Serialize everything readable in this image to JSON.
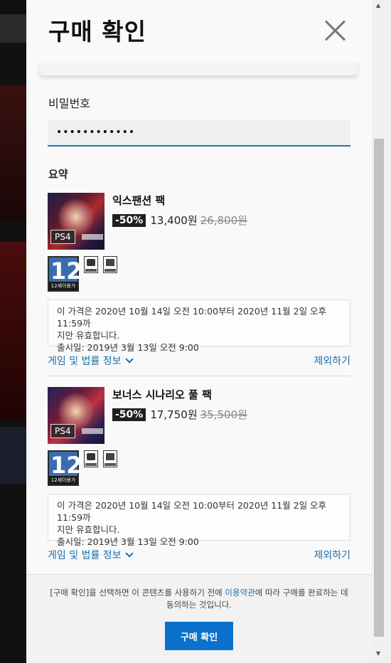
{
  "dialog": {
    "title": "구매 확인"
  },
  "password": {
    "label": "비밀번호",
    "value": "••••••••••••"
  },
  "summary": {
    "title": "요약"
  },
  "items": [
    {
      "name": "익스팬션 팩",
      "platform": "PS4",
      "discount": "-50%",
      "price": "13,400원",
      "original_price": "26,800원",
      "rating_number": "12",
      "rating_caption": "12세이용가",
      "notice_line1": "이 가격은 2020년 10월 14일 오전 10:00부터 2020년 11월 2일 오후 11:59까",
      "notice_line2": "지만 유효합니다.",
      "release_line": "출시일: 2019년 3월 13일 오전 9:00",
      "legal_link": "게임 및 법률 정보",
      "exclude": "제외하기"
    },
    {
      "name": "보너스 시나리오 풀 팩",
      "platform": "PS4",
      "discount": "-50%",
      "price": "17,750원",
      "original_price": "35,500원",
      "rating_number": "12",
      "rating_caption": "12세이용가",
      "notice_line1": "이 가격은 2020년 10월 14일 오전 10:00부터 2020년 11월 2일 오후 11:59까",
      "notice_line2": "지만 유효합니다.",
      "release_line": "출시일: 2019년 3월 13일 오전 9:00",
      "legal_link": "게임 및 법률 정보",
      "exclude": "제외하기"
    }
  ],
  "footer": {
    "terms_before": "[구매 확인]을 선택하면 이 콘텐츠를 사용하기 전에 ",
    "terms_link": "이용약관",
    "terms_after": "에 따라 구매를 완료하는 데 동의하는 것입니다.",
    "confirm_label": "구매 확인"
  },
  "colors": {
    "accent": "#0a72cc",
    "link": "#1f6ea8",
    "badge": "#1f1f1f"
  }
}
